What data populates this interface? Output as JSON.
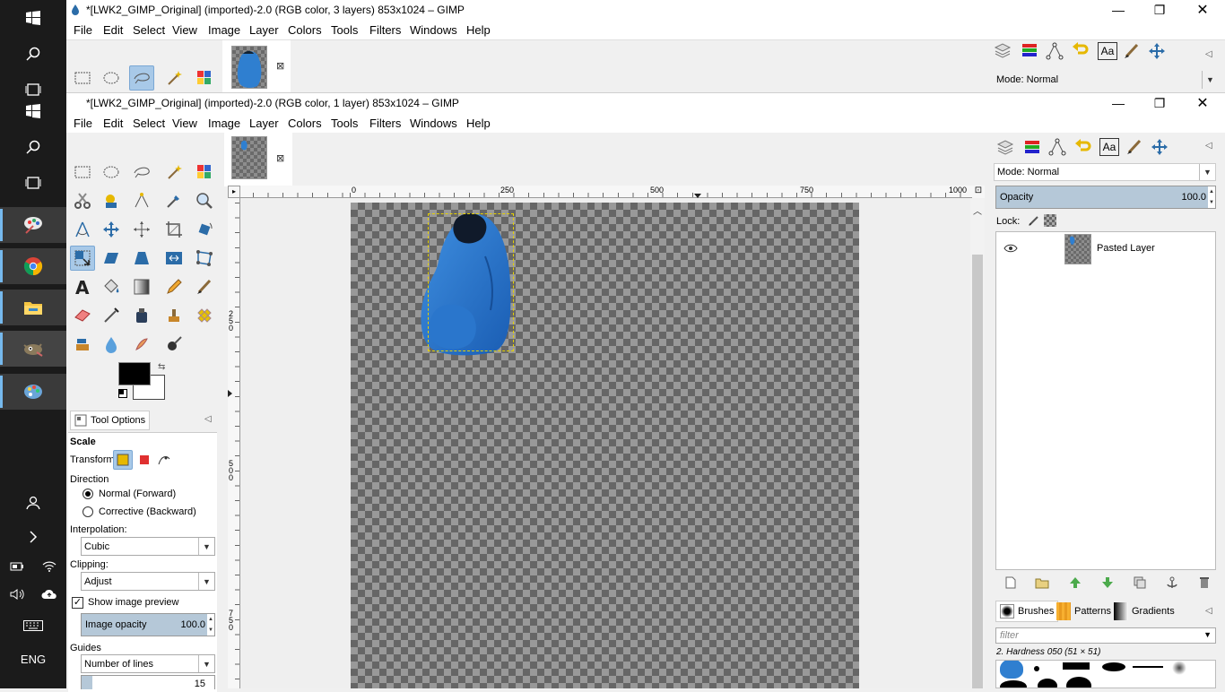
{
  "taskbar": {
    "language": "ENG",
    "icons": [
      "windows-start-icon",
      "search-icon",
      "task-view-icon",
      "windows-start-icon",
      "search-icon",
      "task-view-icon",
      "paint-app-icon",
      "chrome-icon",
      "file-explorer-icon",
      "gimp-icon",
      "paint-palette-icon",
      "people-icon",
      "chevron-right-icon",
      "battery-icon",
      "wifi-icon",
      "volume-icon",
      "cloud-icon",
      "keyboard-icon"
    ]
  },
  "back_window": {
    "title": "*[LWK2_GIMP_Original] (imported)-2.0 (RGB color, 3 layers) 853x1024 – GIMP",
    "menu": [
      "File",
      "Edit",
      "Select",
      "View",
      "Image",
      "Layer",
      "Colors",
      "Tools",
      "Filters",
      "Windows",
      "Help"
    ],
    "mode_label": "Mode: Normal"
  },
  "front_window": {
    "title": "*[LWK2_GIMP_Original] (imported)-2.0 (RGB color, 1 layer) 853x1024 – GIMP",
    "menu": [
      "File",
      "Edit",
      "Select",
      "View",
      "Image",
      "Layer",
      "Colors",
      "Tools",
      "Filters",
      "Windows",
      "Help"
    ]
  },
  "ruler": {
    "top_ticks": [
      "0",
      "250",
      "500",
      "750",
      "1000"
    ],
    "left_ticks": [
      "250",
      "500",
      "750"
    ]
  },
  "tool_options": {
    "tab_label": "Tool Options",
    "tool_name": "Scale",
    "transform_label": "Transform:",
    "direction_label": "Direction",
    "direction_options": [
      "Normal (Forward)",
      "Corrective (Backward)"
    ],
    "direction_selected": 0,
    "interpolation_label": "Interpolation:",
    "interpolation_value": "Cubic",
    "clipping_label": "Clipping:",
    "clipping_value": "Adjust",
    "show_preview_label": "Show image preview",
    "show_preview_checked": true,
    "image_opacity_label": "Image opacity",
    "image_opacity_value": "100.0",
    "guides_label": "Guides",
    "guides_value": "Number of lines",
    "lines_value": "15"
  },
  "layers_panel": {
    "mode_label": "Mode: Normal",
    "opacity_label": "Opacity",
    "opacity_value": "100.0",
    "lock_label": "Lock:",
    "layers": [
      {
        "name": "Pasted Layer",
        "visible": true
      }
    ]
  },
  "brushes_panel": {
    "tabs": [
      "Brushes",
      "Patterns",
      "Gradients"
    ],
    "filter_placeholder": "filter",
    "brush_info": "2. Hardness 050 (51 × 51)"
  },
  "colors": {
    "foreground": "#000000",
    "background": "#ffffff",
    "selection_accent": "#a8c9e8",
    "taskbar_bg": "#1b1b1b"
  }
}
